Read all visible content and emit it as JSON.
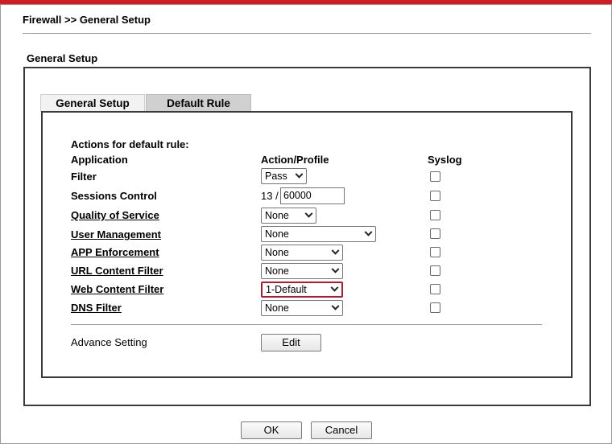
{
  "page": {
    "breadcrumb": "Firewall >> General Setup",
    "section_title": "General Setup"
  },
  "tabs": [
    {
      "label": "General Setup",
      "active": false
    },
    {
      "label": "Default Rule",
      "active": true
    }
  ],
  "form": {
    "intro": "Actions for default rule:",
    "headers": {
      "application": "Application",
      "action": "Action/Profile",
      "syslog": "Syslog"
    },
    "rows": {
      "filter": {
        "label": "Filter",
        "value": "Pass",
        "syslog": false
      },
      "sessions": {
        "label": "Sessions Control",
        "current": "13 /",
        "limit": "60000",
        "syslog": false
      },
      "qos": {
        "label": "Quality of Service",
        "value": "None",
        "syslog": false
      },
      "user_mgmt": {
        "label": "User Management",
        "value": "None",
        "syslog": false
      },
      "app_enf": {
        "label": "APP Enforcement",
        "value": "None",
        "syslog": false
      },
      "url_filter": {
        "label": "URL Content Filter",
        "value": "None",
        "syslog": false
      },
      "web_filter": {
        "label": "Web Content Filter",
        "value": "1-Default",
        "syslog": false
      },
      "dns_filter": {
        "label": "DNS Filter",
        "value": "None",
        "syslog": false
      }
    },
    "advance": {
      "label": "Advance Setting",
      "button": "Edit"
    }
  },
  "footer": {
    "ok": "OK",
    "cancel": "Cancel"
  },
  "colors": {
    "accent_red": "#d71920",
    "highlight_border": "#b01c2b"
  }
}
